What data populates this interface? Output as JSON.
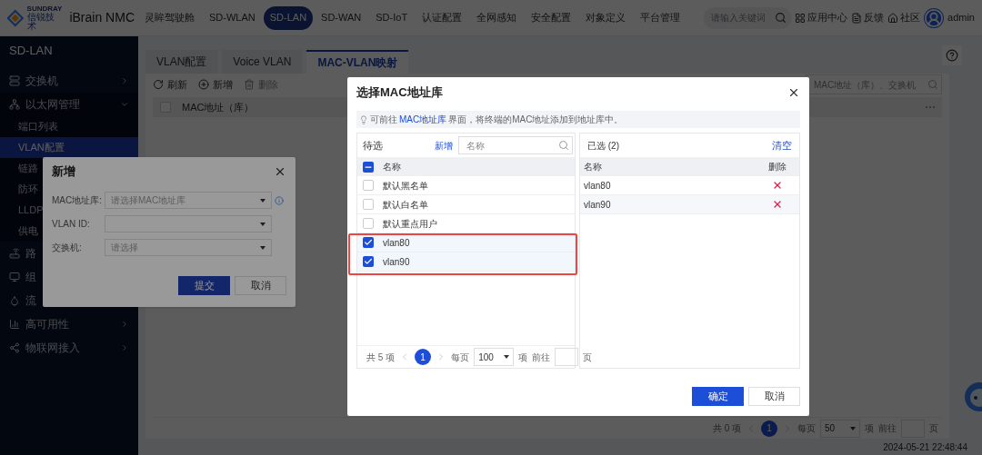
{
  "header": {
    "brand_small": "SUNDRAY",
    "brand_cn": "信锐技术",
    "product": "iBrain NMC",
    "nav": [
      {
        "label": "灵眸驾驶舱",
        "selected": false
      },
      {
        "label": "SD-WLAN",
        "selected": false
      },
      {
        "label": "SD-LAN",
        "selected": true
      },
      {
        "label": "SD-WAN",
        "selected": false
      },
      {
        "label": "SD-IoT",
        "selected": false
      },
      {
        "label": "认证配置",
        "selected": false
      },
      {
        "label": "全网感知",
        "selected": false
      },
      {
        "label": "安全配置",
        "selected": false
      },
      {
        "label": "对象定义",
        "selected": false
      },
      {
        "label": "平台管理",
        "selected": false
      }
    ],
    "search": {
      "placeholder": "请输入关键词"
    },
    "links": [
      "应用中心",
      "反馈",
      "社区"
    ],
    "user": "admin"
  },
  "sidebar": {
    "title": "SD-LAN",
    "items": [
      {
        "label": "交换机",
        "expanded": false
      },
      {
        "label": "以太网管理",
        "expanded": true,
        "children": [
          {
            "label": "端口列表",
            "selected": false
          },
          {
            "label": "VLAN配置",
            "selected": true
          },
          {
            "label": "链路",
            "selected": false
          },
          {
            "label": "防环",
            "selected": false
          },
          {
            "label": "LLDP",
            "selected": false
          },
          {
            "label": "供电",
            "selected": false
          }
        ]
      },
      {
        "label": "路"
      },
      {
        "label": "组"
      },
      {
        "label": "流"
      },
      {
        "label": "高可用性",
        "expanded": false
      },
      {
        "label": "物联网接入",
        "expanded": false
      }
    ]
  },
  "main": {
    "tabs": [
      {
        "label": "VLAN配置",
        "selected": false
      },
      {
        "label": "Voice VLAN",
        "selected": false
      },
      {
        "label": "MAC-VLAN映射",
        "selected": true
      }
    ],
    "toolbar": [
      {
        "label": "刷新",
        "disabled": false
      },
      {
        "label": "新增",
        "disabled": false
      },
      {
        "label": "删除",
        "disabled": true
      }
    ],
    "search": {
      "placeholder": "MAC地址（库）、交换机"
    },
    "table": {
      "header_checked": false,
      "columns": [
        "MAC地址（库）"
      ]
    },
    "pagination": {
      "total": "共 0 项",
      "page": "1",
      "per_page_label": "每页",
      "per_page": "50",
      "unit": "项",
      "goto": "前往",
      "page_unit": "页"
    },
    "timestamp": "2024-05-21 22:48:44"
  },
  "add_dialog": {
    "title": "新增",
    "fields": [
      {
        "label": "MAC地址库:",
        "placeholder": "请选择MAC地址库",
        "info": true
      },
      {
        "label": "VLAN ID:",
        "info": false
      },
      {
        "label": "交换机:",
        "placeholder": "请选择",
        "info": false
      }
    ],
    "buttons": [
      {
        "label": "提交",
        "primary": true
      },
      {
        "label": "取消",
        "primary": false
      }
    ]
  },
  "modal": {
    "title": "选择MAC地址库",
    "hint_before": "可前往",
    "hint_link": "MAC地址库",
    "hint_after": "界面，将终端的MAC地址添加到地址库中。",
    "left": {
      "title": "待选",
      "add_link": "新增",
      "search": {
        "placeholder": "名称"
      },
      "header_partial": true,
      "column": "名称",
      "rows": [
        {
          "name": "默认黑名单",
          "checked": false
        },
        {
          "name": "默认白名单",
          "checked": false
        },
        {
          "name": "默认重点用户",
          "checked": false
        },
        {
          "name": "vlan80",
          "checked": true
        },
        {
          "name": "vlan90",
          "checked": true
        }
      ],
      "pagination": {
        "total": "共 5 项",
        "page": "1",
        "per_page_label": "每页",
        "per_page": "100",
        "unit": "项",
        "goto": "前往",
        "page_unit": "页"
      }
    },
    "right": {
      "title": "已选 (2)",
      "clear": "清空",
      "columns": [
        "名称",
        "删除"
      ],
      "rows": [
        "vlan80",
        "vlan90"
      ]
    },
    "buttons": [
      {
        "label": "确定",
        "primary": true
      },
      {
        "label": "取消",
        "primary": false
      }
    ]
  }
}
